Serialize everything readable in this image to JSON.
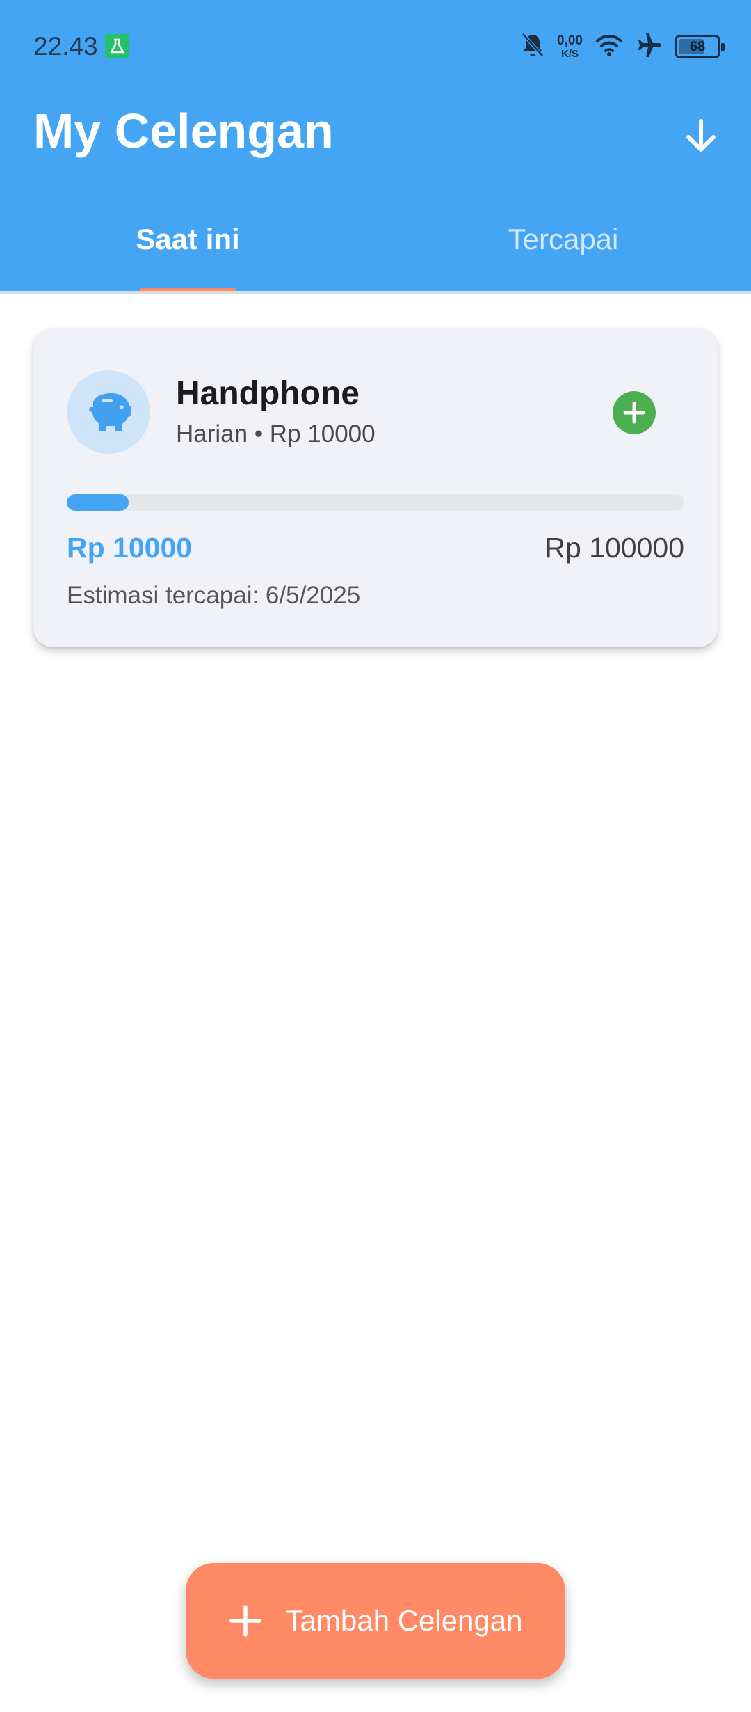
{
  "status_bar": {
    "time": "22.43",
    "net_speed_value": "0,00",
    "net_speed_unit": "K/S",
    "battery_level": 68,
    "battery_label": "68",
    "icons": [
      "lab-icon",
      "bell-off-icon",
      "wifi-icon",
      "airplane-icon",
      "battery-icon"
    ]
  },
  "header": {
    "title": "My Celengan",
    "action_icon": "arrow-down-icon",
    "tabs": [
      {
        "label": "Saat ini",
        "selected": true
      },
      {
        "label": "Tercapai",
        "selected": false
      }
    ]
  },
  "goals": [
    {
      "icon": "piggy-bank-icon",
      "name": "Handphone",
      "subtitle": "Harian • Rp 10000",
      "progress_fraction": 0.1,
      "saved": "Rp 10000",
      "target": "Rp 100000",
      "estimate": "Estimasi tercapai: 6/5/2025",
      "add_icon": "plus-circle-icon"
    }
  ],
  "fab": {
    "icon": "plus-icon",
    "label": "Tambah Celengan"
  },
  "colors": {
    "primary": "#45A5F5",
    "accent": "#FF8A65",
    "success": "#4CAF50",
    "card_bg": "#F1F2F7"
  }
}
